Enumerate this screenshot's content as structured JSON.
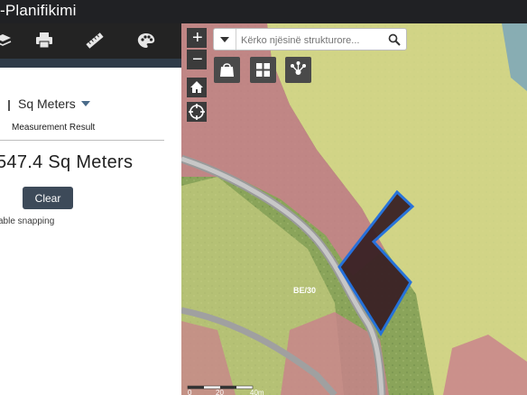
{
  "app": {
    "title": "-Planifikimi"
  },
  "toolbar": {
    "icons": [
      "layers-icon",
      "print-icon",
      "measure-ruler-icon",
      "palette-icon"
    ]
  },
  "measurement": {
    "unit_label": "Sq Meters",
    "header": "Measurement Result",
    "result": "547.4 Sq Meters",
    "clear_label": "Clear",
    "snapping_text": "able snapping"
  },
  "map": {
    "search_placeholder": "Kërko njësinë strukturore...",
    "parcel_label": "BE/30",
    "scale": {
      "labels": [
        "0",
        "20",
        "40m"
      ]
    },
    "colors": {
      "residential_zone": "#c9818c",
      "agricultural_zone": "#d7d98a",
      "selection_outline": "#1f6fe0",
      "selection_fill": "#3a2125"
    }
  }
}
